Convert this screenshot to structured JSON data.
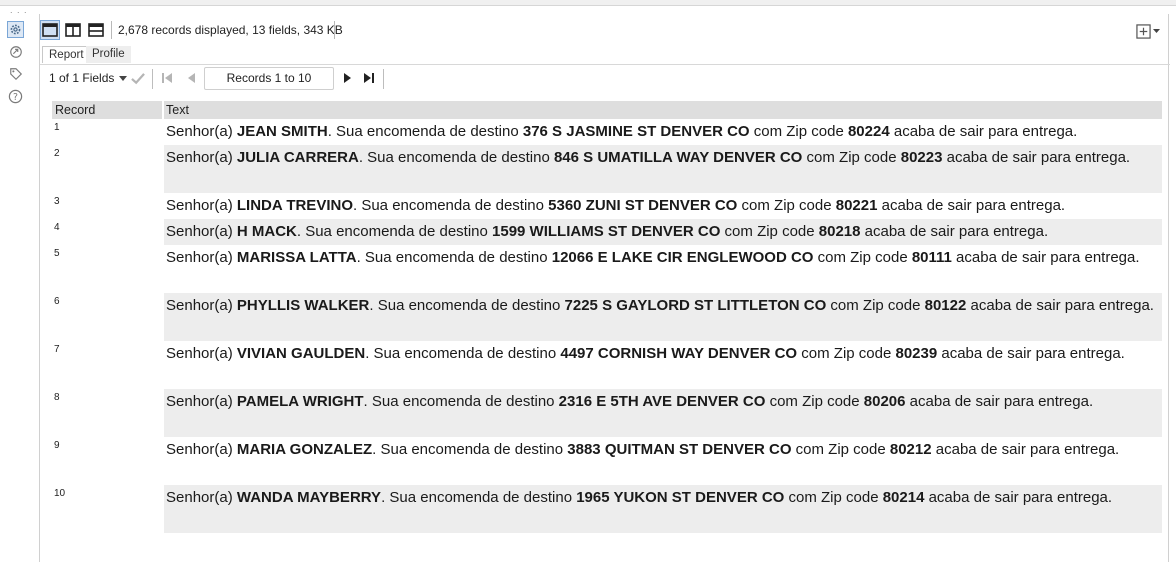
{
  "summary": "2,678 records displayed, 13 fields, 343 KB",
  "tabs": [
    "Report",
    "Profile"
  ],
  "nav": {
    "fields_selector": "1 of 1 Fields",
    "records_range": "Records 1 to 10"
  },
  "columns": [
    "Record",
    "Text"
  ],
  "message_parts": {
    "prefix": "Senhor(a) ",
    "mid1": ". Sua encomenda de destino ",
    "mid2": " com Zip code ",
    "suffix": " acaba de sair para entrega."
  },
  "rows": [
    {
      "record": "1",
      "name": "JEAN SMITH",
      "address": "376 S JASMINE ST DENVER CO",
      "zip": "80224"
    },
    {
      "record": "2",
      "name": "JULIA CARRERA",
      "address": "846 S UMATILLA WAY DENVER CO",
      "zip": "80223"
    },
    {
      "record": "3",
      "name": "LINDA TREVINO",
      "address": "5360 ZUNI ST DENVER CO",
      "zip": "80221"
    },
    {
      "record": "4",
      "name": "H MACK",
      "address": "1599 WILLIAMS ST DENVER CO",
      "zip": "80218"
    },
    {
      "record": "5",
      "name": "MARISSA LATTA",
      "address": "12066 E LAKE CIR ENGLEWOOD CO",
      "zip": "80111"
    },
    {
      "record": "6",
      "name": "PHYLLIS WALKER",
      "address": "7225 S GAYLORD ST LITTLETON CO",
      "zip": "80122"
    },
    {
      "record": "7",
      "name": "VIVIAN GAULDEN",
      "address": "4497 CORNISH WAY DENVER CO",
      "zip": "80239"
    },
    {
      "record": "8",
      "name": "PAMELA WRIGHT",
      "address": "2316 E 5TH AVE DENVER CO",
      "zip": "80206"
    },
    {
      "record": "9",
      "name": "MARIA GONZALEZ",
      "address": "3883 QUITMAN ST DENVER CO",
      "zip": "80212"
    },
    {
      "record": "10",
      "name": "WANDA MAYBERRY",
      "address": "1965 YUKON ST DENVER CO",
      "zip": "80214"
    }
  ],
  "colors": {
    "header_bg": "#dedede",
    "alt_row_bg": "#ededed",
    "accent_border": "#7aa6d6"
  }
}
